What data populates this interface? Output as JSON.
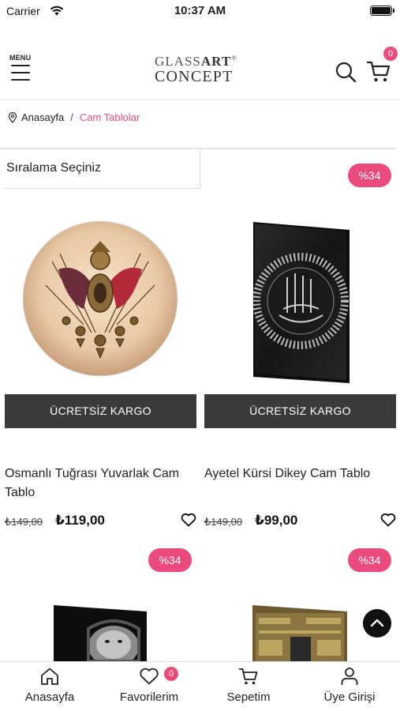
{
  "status_bar": {
    "carrier": "Carrier",
    "time": "10:37 AM"
  },
  "header": {
    "menu_label": "MENU",
    "logo_glass": "GLASS",
    "logo_art": "ART",
    "logo_reg": "®",
    "logo_concept": "CONCEPT",
    "cart_count": "0"
  },
  "breadcrumb": {
    "home": "Anasayfa",
    "separator": "/",
    "current": "Cam Tablolar"
  },
  "sort": {
    "label": "Sıralama Seçiniz"
  },
  "products": [
    {
      "discount": "%34",
      "shipping_label": "ÜCRETSİZ KARGO",
      "name": "Osmanlı Tuğrası Yuvarlak Cam Tablo",
      "old_price": "₺149,00",
      "price": "₺119,00"
    },
    {
      "discount": "%34",
      "shipping_label": "ÜCRETSİZ KARGO",
      "name": "Ayetel Kürsi Dikey Cam Tablo",
      "old_price": "₺149,00",
      "price": "₺99,00"
    },
    {
      "discount": "%34"
    },
    {
      "discount": "%34"
    }
  ],
  "bottom_nav": {
    "home": "Anasayfa",
    "favorites": "Favorilerim",
    "favorites_count": "0",
    "cart": "Sepetim",
    "login": "Üye Girişi"
  },
  "colors": {
    "accent": "#ea4a7d",
    "button_dark": "#3a3a3a"
  }
}
